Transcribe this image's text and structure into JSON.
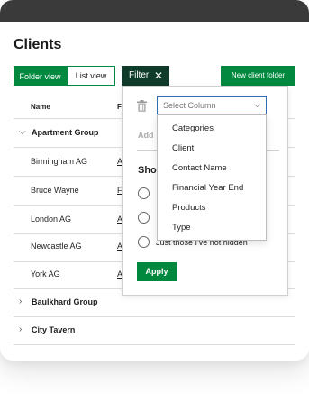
{
  "page": {
    "title": "Clients"
  },
  "toolbar": {
    "folder_view": "Folder view",
    "list_view": "List view",
    "filter": "Filter",
    "new_client_folder": "New client folder"
  },
  "table": {
    "headers": [
      "Name",
      "F"
    ],
    "groups": [
      {
        "label": "Apartment Group",
        "expanded": true,
        "children": [
          {
            "name": "Birmingham AG",
            "col2": "A"
          },
          {
            "name": "Bruce Wayne",
            "col2": "F"
          },
          {
            "name": "London AG",
            "col2": "A"
          },
          {
            "name": "Newcastle AG",
            "col2": "A"
          },
          {
            "name": "York AG",
            "col2": "A"
          }
        ]
      },
      {
        "label": "Baulkhard Group",
        "expanded": false
      },
      {
        "label": "City Tavern",
        "expanded": false
      }
    ]
  },
  "filter_panel": {
    "select_placeholder": "Select Column",
    "add_label": "Add",
    "show_label": "Sho",
    "radio_options": [
      "",
      "",
      "Just those I've not hidden"
    ],
    "apply": "Apply",
    "dropdown_options": [
      "Categories",
      "Client",
      "Contact Name",
      "Financial Year End",
      "Products",
      "Type"
    ]
  },
  "colors": {
    "brand_green": "#00883e",
    "filter_dark": "#0f3b2a",
    "focus_blue": "#2c6db3"
  },
  "icons": {
    "trash": "trash-icon",
    "close": "close-icon",
    "chevron_down": "chevron-down-icon",
    "chevron_right": "chevron-right-icon"
  }
}
